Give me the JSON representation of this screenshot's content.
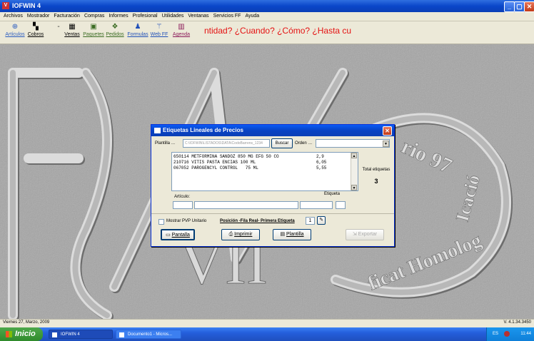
{
  "window": {
    "title": "IOFWIN 4",
    "minimize": "_",
    "maximize": "▢",
    "close": "✕"
  },
  "menu": [
    "Archivos",
    "Mostrador",
    "Facturación",
    "Compras",
    "Informes",
    "Profesional",
    "Utilidades",
    "Ventanas",
    "Servicios FF",
    "Ayuda"
  ],
  "toolbar": [
    {
      "label": "Artículos",
      "icon": "articles-icon",
      "glyph": "⊕"
    },
    {
      "label": "Cobros",
      "icon": "payments-icon",
      "glyph": "▚"
    },
    {
      "label": "Ventas",
      "icon": "sales-icon",
      "glyph": "▦"
    },
    {
      "label": "Paquetes",
      "icon": "packages-icon",
      "glyph": "▣"
    },
    {
      "label": "Pedidos",
      "icon": "orders-icon",
      "glyph": "❖"
    },
    {
      "label": "Formulas",
      "icon": "formulas-icon",
      "glyph": "♟"
    },
    {
      "label": "Web FF",
      "icon": "web-icon",
      "glyph": "⚚"
    },
    {
      "label": "Agenda",
      "icon": "agenda-icon",
      "glyph": "▥"
    }
  ],
  "marquee": "ntidad? ¿Cuando? ¿Cómo? ¿Hasta cu",
  "dialog": {
    "title": "Etiquetas Lineales de Precios",
    "plantilla_label": "Plantilla",
    "plantilla_path": "C:\\IOFWIN\\LISTADOS\\DATA\\CodoBarrens_1234",
    "buscar": "Buscar",
    "orden_label": "Orden",
    "orden_value": "",
    "items": [
      {
        "code": "650114",
        "desc": "METFORMINA SANDOZ 850 MG EFG 50 CO",
        "qty": "2,9"
      },
      {
        "code": "210716",
        "desc": "VITIS PASTA ENCIAS 100 ML",
        "qty": "6,05"
      },
      {
        "code": "067052",
        "desc": "PAROGENCYL CONTROL   75 ML",
        "qty": "5,55"
      }
    ],
    "total_label": "Total etiquetas",
    "total_value": "3",
    "articulo_label": "Artículo:",
    "etiqueta_label": "Etiqueta",
    "pvp_label": "Mostrar PVP Unitario",
    "posicion_label": "Posición -Fila Real- Primera Etiqueta",
    "posicion_value": "1",
    "btn_pantalla": "Pantalla",
    "btn_imprimir": "Imprimir",
    "btn_plantilla": "Plantilla",
    "btn_exportar": "Exportar"
  },
  "status": {
    "date": "Viernes 27, Marzo, 2009",
    "version": "V. 4.1.34.3450"
  },
  "taskbar": {
    "start": "Inicio",
    "tasks": [
      "IOFWIN 4",
      "Documento1 - Micros..."
    ],
    "tray_lang": "ES",
    "clock": "11:44"
  },
  "desktop_text": {
    "ring_text": "...rio 97 ... Icacio ...ficat Homologació",
    "numeral": "VII"
  }
}
